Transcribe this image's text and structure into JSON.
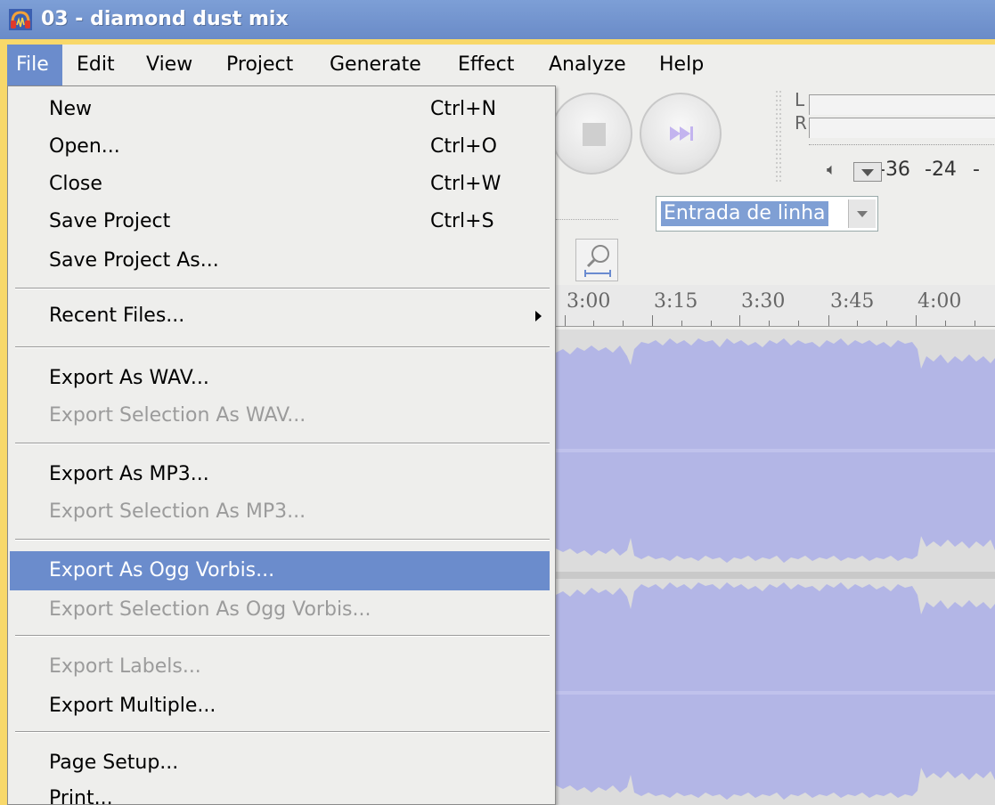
{
  "window": {
    "title": "03 - diamond dust mix",
    "icon": "audacity-headphones-icon"
  },
  "menubar": {
    "items": [
      {
        "label": "File",
        "active": true
      },
      {
        "label": "Edit"
      },
      {
        "label": "View"
      },
      {
        "label": "Project"
      },
      {
        "label": "Generate"
      },
      {
        "label": "Effect"
      },
      {
        "label": "Analyze"
      },
      {
        "label": "Help"
      }
    ]
  },
  "meter": {
    "left_label": "L",
    "right_label": "R",
    "scale": [
      "-36",
      "-24",
      "-"
    ]
  },
  "input_select": {
    "value": "Entrada de linha"
  },
  "timeline": {
    "ticks": [
      "3:00",
      "3:15",
      "3:30",
      "3:45",
      "4:00"
    ]
  },
  "file_menu": {
    "items": [
      {
        "label": "New",
        "shortcut": "Ctrl+N"
      },
      {
        "label": "Open...",
        "shortcut": "Ctrl+O"
      },
      {
        "label": "Close",
        "shortcut": "Ctrl+W"
      },
      {
        "label": "Save Project",
        "shortcut": "Ctrl+S"
      },
      {
        "label": "Save Project As...",
        "shortcut": ""
      },
      {
        "label": "Recent Files...",
        "shortcut": "",
        "submenu": true
      },
      {
        "label": "Export As WAV...",
        "shortcut": ""
      },
      {
        "label": "Export Selection As WAV...",
        "shortcut": "",
        "disabled": true
      },
      {
        "label": "Export As MP3...",
        "shortcut": ""
      },
      {
        "label": "Export Selection As MP3...",
        "shortcut": "",
        "disabled": true
      },
      {
        "label": "Export As Ogg Vorbis...",
        "shortcut": "",
        "highlighted": true
      },
      {
        "label": "Export Selection As Ogg Vorbis...",
        "shortcut": "",
        "disabled": true
      },
      {
        "label": "Export Labels...",
        "shortcut": "",
        "disabled": true
      },
      {
        "label": "Export Multiple...",
        "shortcut": ""
      },
      {
        "label": "Page Setup...",
        "shortcut": ""
      },
      {
        "label": "Print...",
        "shortcut": ""
      }
    ]
  },
  "colors": {
    "titlebar": "#7d9fd6",
    "menu_highlight": "#6b8ccc",
    "waveform": "#b3b6e6",
    "frame": "#f8d86a"
  }
}
